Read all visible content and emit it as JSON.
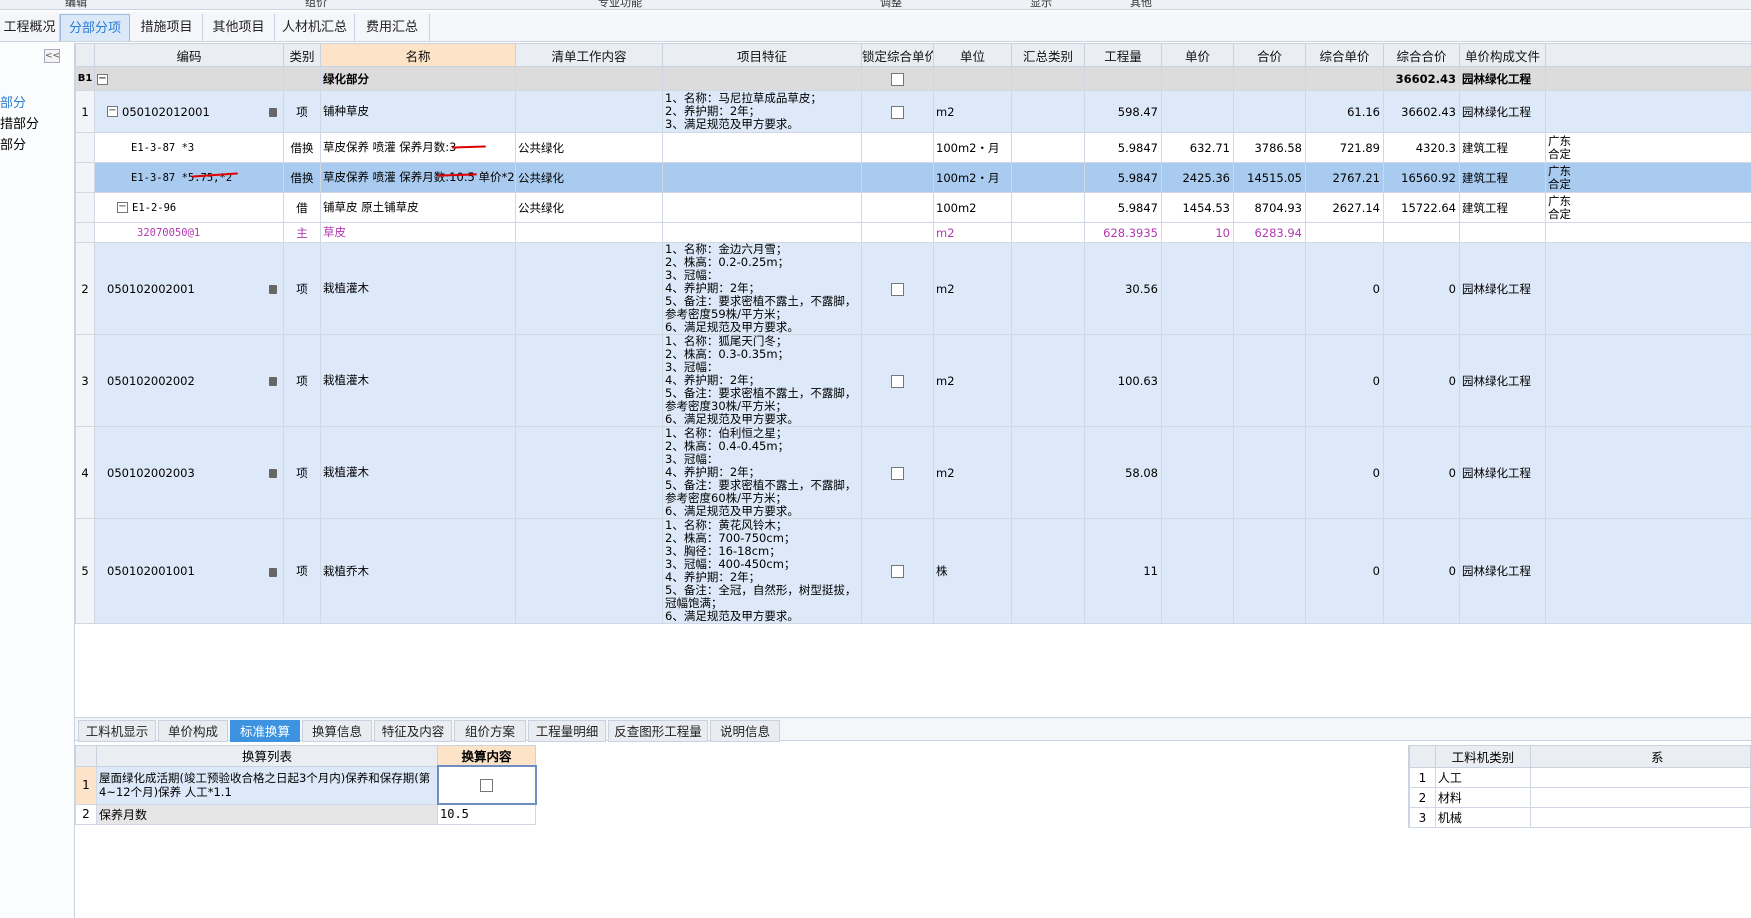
{
  "ribbon": {
    "groups": [
      "编辑",
      "组价",
      "专业功能",
      "调整",
      "显示",
      "其他"
    ]
  },
  "tabs": [
    "工程概况",
    "分部分项",
    "措施项目",
    "其他项目",
    "人材机汇总",
    "费用汇总"
  ],
  "left_panel": {
    "collapse": "<<",
    "items": [
      "部分",
      "措部分",
      "部分"
    ]
  },
  "grid": {
    "headers": [
      "编码",
      "类别",
      "名称",
      "清单工作内容",
      "项目特征",
      "锁定综合单价",
      "单位",
      "汇总类别",
      "工程量",
      "单价",
      "合价",
      "综合单价",
      "综合合价",
      "单价构成文件",
      ""
    ],
    "section": {
      "no": "B1",
      "name": "绿化部分",
      "total": "36602.43",
      "file": "园林绿化工程"
    },
    "rows": [
      {
        "no": "1",
        "code": "050102012001",
        "type": "项",
        "name": "铺种草皮",
        "content": "",
        "features": "1、名称：马尼拉草成品草皮；\n2、养护期：2年；\n3、满足规范及甲方要求。",
        "unit": "m2",
        "sumcat": "",
        "qty": "598.47",
        "price": "",
        "total": "",
        "uprice": "61.16",
        "utotal": "36602.43",
        "file": "园林绿化工程",
        "extra": ""
      },
      {
        "no": "",
        "code": "E1-3-87 *3",
        "type": "借换",
        "name": "草皮保养 喷灌  保养月数:3",
        "content": "公共绿化",
        "features": "",
        "unit": "100m2・月",
        "sumcat": "",
        "qty": "5.9847",
        "price": "632.71",
        "total": "3786.58",
        "uprice": "721.89",
        "utotal": "4320.3",
        "file": "建筑工程",
        "extra": "广东\n合定"
      },
      {
        "no": "",
        "code": "E1-3-87 *5.75,*2",
        "type": "借换",
        "name": "草皮保养 喷灌  保养月数:10.5  单价*2",
        "content": "公共绿化",
        "features": "",
        "unit": "100m2・月",
        "sumcat": "",
        "qty": "5.9847",
        "price": "2425.36",
        "total": "14515.05",
        "uprice": "2767.21",
        "utotal": "16560.92",
        "file": "建筑工程",
        "extra": "广东\n合定"
      },
      {
        "no": "",
        "code": "E1-2-96",
        "type": "借",
        "name": "铺草皮 原土铺草皮",
        "content": "公共绿化",
        "features": "",
        "unit": "100m2",
        "sumcat": "",
        "qty": "5.9847",
        "price": "1454.53",
        "total": "8704.93",
        "uprice": "2627.14",
        "utotal": "15722.64",
        "file": "建筑工程",
        "extra": "广东\n合定"
      },
      {
        "no": "",
        "code": "32070050@1",
        "type": "主",
        "name": "草皮",
        "content": "",
        "features": "",
        "unit": "m2",
        "sumcat": "",
        "qty": "628.3935",
        "price": "10",
        "total": "6283.94",
        "uprice": "",
        "utotal": "",
        "file": "",
        "extra": ""
      },
      {
        "no": "2",
        "code": "050102002001",
        "type": "项",
        "name": "栽植灌木",
        "content": "",
        "features": "1、名称：金边六月雪；\n2、株高：0.2-0.25m；\n3、冠幅：\n4、养护期：2年；\n5、备注：要求密植不露土，不露脚，参考密度59株/平方米；\n6、满足规范及甲方要求。",
        "unit": "m2",
        "sumcat": "",
        "qty": "30.56",
        "price": "",
        "total": "",
        "uprice": "0",
        "utotal": "0",
        "file": "园林绿化工程",
        "extra": ""
      },
      {
        "no": "3",
        "code": "050102002002",
        "type": "项",
        "name": "栽植灌木",
        "content": "",
        "features": "1、名称：狐尾天门冬；\n2、株高：0.3-0.35m；\n3、冠幅：\n4、养护期：2年；\n5、备注：要求密植不露土，不露脚，参考密度30株/平方米；\n6、满足规范及甲方要求。",
        "unit": "m2",
        "sumcat": "",
        "qty": "100.63",
        "price": "",
        "total": "",
        "uprice": "0",
        "utotal": "0",
        "file": "园林绿化工程",
        "extra": ""
      },
      {
        "no": "4",
        "code": "050102002003",
        "type": "项",
        "name": "栽植灌木",
        "content": "",
        "features": "1、名称：伯利恒之星；\n2、株高：0.4-0.45m；\n3、冠幅：\n4、养护期：2年；\n5、备注：要求密植不露土，不露脚，参考密度60株/平方米；\n6、满足规范及甲方要求。",
        "unit": "m2",
        "sumcat": "",
        "qty": "58.08",
        "price": "",
        "total": "",
        "uprice": "0",
        "utotal": "0",
        "file": "园林绿化工程",
        "extra": ""
      },
      {
        "no": "5",
        "code": "050102001001",
        "type": "项",
        "name": "栽植乔木",
        "content": "",
        "features": "1、名称：黄花风铃木；\n2、株高：700-750cm；\n3、胸径：16-18cm；\n3、冠幅：400-450cm；\n4、养护期：2年；\n5、备注：全冠，自然形，树型挺拔，冠幅饱满；\n6、满足规范及甲方要求。",
        "unit": "株",
        "sumcat": "",
        "qty": "11",
        "price": "",
        "total": "",
        "uprice": "0",
        "utotal": "0",
        "file": "园林绿化工程",
        "extra": ""
      }
    ]
  },
  "bottom_tabs": [
    "工料机显示",
    "单价构成",
    "标准换算",
    "换算信息",
    "特征及内容",
    "组价方案",
    "工程量明细",
    "反查图形工程量",
    "说明信息"
  ],
  "conversion": {
    "headers": [
      "换算列表",
      "换算内容"
    ],
    "rows": [
      {
        "no": "1",
        "item": "屋面绿化成活期(竣工预验收合格之日起3个月内)保养和保存期(第4~12个月)保养 人工*1.1",
        "value": ""
      },
      {
        "no": "2",
        "item": "保养月数",
        "value": "10.5"
      }
    ]
  },
  "resource": {
    "headers": [
      "工料机类别",
      "系"
    ],
    "rows": [
      {
        "no": "1",
        "cat": "人工"
      },
      {
        "no": "2",
        "cat": "材料"
      },
      {
        "no": "3",
        "cat": "机械"
      }
    ]
  },
  "colors": {
    "accent": "#2b7bd3",
    "selected_row": "#a9cbef",
    "item_row": "#dde9f8",
    "material_text": "#b03ab0",
    "annotation": "#e00000"
  }
}
